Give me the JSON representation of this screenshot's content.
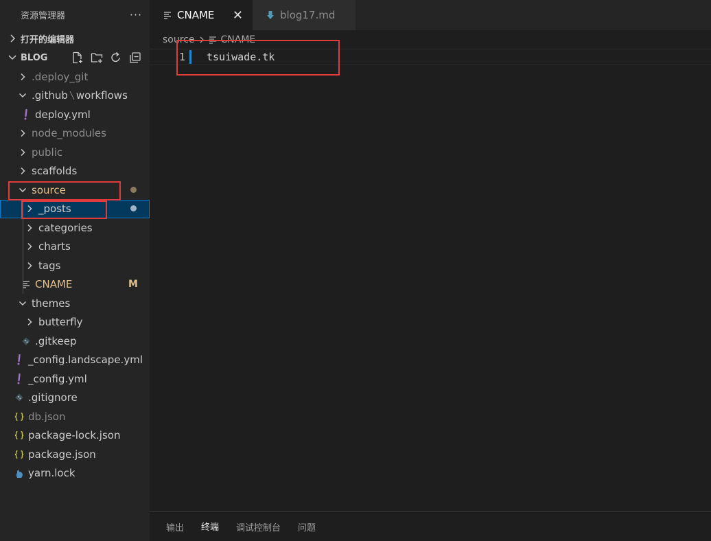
{
  "explorer": {
    "title": "资源管理器",
    "more": "···",
    "open_editors": "打开的编辑器",
    "workspace": "BLOG",
    "actions": [
      "new-file-icon",
      "new-folder-icon",
      "refresh-icon",
      "collapse-all-icon"
    ]
  },
  "tree": [
    {
      "label": ".deploy_git",
      "kind": "folder-collapsed",
      "depth": 0,
      "dim": true
    },
    {
      "label": ".github",
      "label2": "workflows",
      "kind": "folder-expanded",
      "depth": 0
    },
    {
      "label": "deploy.yml",
      "kind": "yaml",
      "depth": 1
    },
    {
      "label": "node_modules",
      "kind": "folder-collapsed",
      "depth": 0,
      "dim": true
    },
    {
      "label": "public",
      "kind": "folder-collapsed",
      "depth": 0,
      "dim": true
    },
    {
      "label": "scaffolds",
      "kind": "folder-collapsed",
      "depth": 0
    },
    {
      "label": "source",
      "kind": "folder-expanded",
      "depth": 0,
      "modified": true,
      "decoration": "dot"
    },
    {
      "label": "_posts",
      "kind": "folder-collapsed",
      "depth": 1,
      "selected": true,
      "decoration": "dot"
    },
    {
      "label": "categories",
      "kind": "folder-collapsed",
      "depth": 1
    },
    {
      "label": "charts",
      "kind": "folder-collapsed",
      "depth": 1
    },
    {
      "label": "tags",
      "kind": "folder-collapsed",
      "depth": 1
    },
    {
      "label": "CNAME",
      "kind": "text",
      "depth": 1,
      "modified": true,
      "decoration": "M"
    },
    {
      "label": "themes",
      "kind": "folder-expanded",
      "depth": 0
    },
    {
      "label": "butterfly",
      "kind": "folder-collapsed",
      "depth": 1
    },
    {
      "label": ".gitkeep",
      "kind": "git",
      "depth": 1
    },
    {
      "label": "_config.landscape.yml",
      "kind": "yaml",
      "depth": 0
    },
    {
      "label": "_config.yml",
      "kind": "yaml",
      "depth": 0
    },
    {
      "label": ".gitignore",
      "kind": "git",
      "depth": 0
    },
    {
      "label": "db.json",
      "kind": "json",
      "depth": 0,
      "dim": true
    },
    {
      "label": "package-lock.json",
      "kind": "json",
      "depth": 0
    },
    {
      "label": "package.json",
      "kind": "json",
      "depth": 0
    },
    {
      "label": "yarn.lock",
      "kind": "yarn",
      "depth": 0
    }
  ],
  "tabs": [
    {
      "label": "CNAME",
      "active": true,
      "close": "✕"
    },
    {
      "label": "blog17.md",
      "active": false
    }
  ],
  "breadcrumb": [
    "source",
    "CNAME"
  ],
  "editor": {
    "line_number": "1",
    "code": "tsuiwade.tk"
  },
  "panel_tabs": [
    {
      "label": "输出",
      "active": false
    },
    {
      "label": "终端",
      "active": true
    },
    {
      "label": "调试控制台",
      "active": false
    },
    {
      "label": "问题",
      "active": false
    }
  ],
  "colors": {
    "modified": "#e2c08d",
    "dot_modified": "#8b7a5c",
    "dot_selected": "#9fb4c9",
    "yaml": "#a074c4",
    "json": "#cbcb41",
    "highlight_box": "#e03c3c",
    "selection": "#04395e"
  }
}
